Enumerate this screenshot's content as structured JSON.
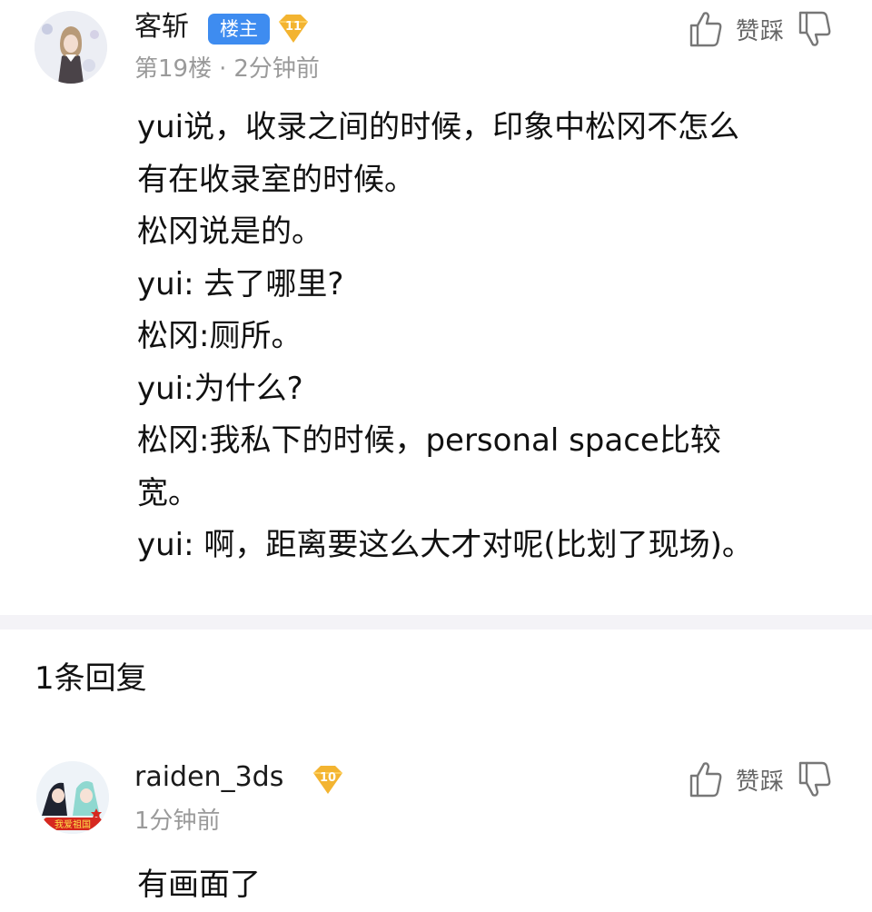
{
  "post": {
    "username": "客斩",
    "owner_badge": "楼主",
    "level": "11",
    "floor": "第19楼",
    "separator": "·",
    "time": "2分钟前",
    "vote_label": "赞踩",
    "lines": [
      "yui说，收录之间的时候，印象中松冈不怎么",
      "有在收录室的时候。",
      "松冈说是的。",
      "yui: 去了哪里?",
      "松冈:厕所。",
      "yui:为什么?",
      "松冈:我私下的时候，personal space比较",
      "宽。",
      "yui: 啊，距离要这么大才对呢(比划了现场)。"
    ]
  },
  "replies_header": "1条回复",
  "reply": {
    "username": "raiden_3ds",
    "level": "10",
    "time": "1分钟前",
    "vote_label": "赞踩",
    "avatar_caption": "我爱祖国",
    "text": "有画面了"
  },
  "colors": {
    "owner_badge": "#3e8cf0",
    "level_badge": "#f3b431",
    "meta_text": "#9a9a9a",
    "divider": "#f4f3f7"
  },
  "icons": {
    "like": "thumbs-up-icon",
    "dislike": "thumbs-down-icon",
    "level": "level-diamond-icon"
  }
}
